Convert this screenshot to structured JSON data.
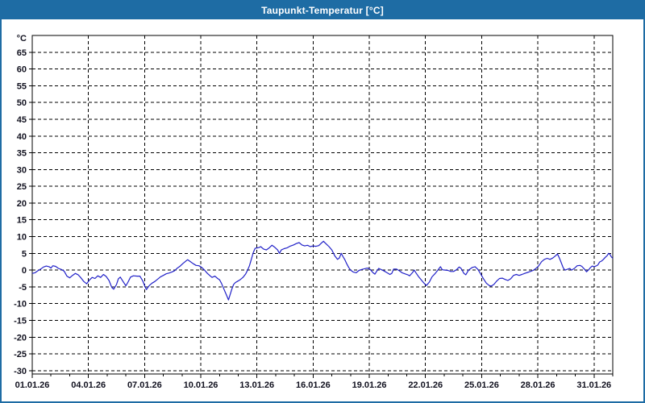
{
  "window": {
    "title": "Taupunkt-Temperatur [°C]",
    "titlebar_color": "#1e6ca4",
    "border_color": "#1e6ca4",
    "content_background": "#ffffff"
  },
  "chart_data": {
    "type": "line",
    "title": "Taupunkt-Temperatur [°C]",
    "y_unit_label": "°C",
    "ylabel": "",
    "xlabel": "",
    "ylim": [
      -31,
      70
    ],
    "y_ticks": [
      65,
      60,
      55,
      50,
      45,
      40,
      35,
      30,
      25,
      20,
      15,
      10,
      5,
      0,
      -5,
      -10,
      -15,
      -20,
      -25,
      -30
    ],
    "x_total_days": 31,
    "x_ticks": [
      {
        "day": 0,
        "label": "01.01.26"
      },
      {
        "day": 3,
        "label": "04.01.26"
      },
      {
        "day": 6,
        "label": "07.01.26"
      },
      {
        "day": 9,
        "label": "10.01.26"
      },
      {
        "day": 12,
        "label": "13.01.26"
      },
      {
        "day": 15,
        "label": "16.01.26"
      },
      {
        "day": 18,
        "label": "19.01.26"
      },
      {
        "day": 21,
        "label": "22.01.26"
      },
      {
        "day": 24,
        "label": "25.01.26"
      },
      {
        "day": 27,
        "label": "28.01.26"
      },
      {
        "day": 30,
        "label": "31.01.26"
      }
    ],
    "x_minor_tick_every_days": 1,
    "grid": "dashed",
    "grid_color": "#000000",
    "axis_color": "#000000",
    "line_color": "#2121c8",
    "legend": "none",
    "series": [
      {
        "name": "Taupunkt-Temperatur",
        "points": [
          [
            0.0,
            -1.0
          ],
          [
            0.15,
            -0.8
          ],
          [
            0.3,
            -0.2
          ],
          [
            0.45,
            0.3
          ],
          [
            0.6,
            0.9
          ],
          [
            0.75,
            1.2
          ],
          [
            0.9,
            1.0
          ],
          [
            1.0,
            0.6
          ],
          [
            1.1,
            1.3
          ],
          [
            1.25,
            1.1
          ],
          [
            1.4,
            0.5
          ],
          [
            1.55,
            0.2
          ],
          [
            1.7,
            -0.3
          ],
          [
            1.85,
            -1.8
          ],
          [
            2.0,
            -2.3
          ],
          [
            2.15,
            -1.6
          ],
          [
            2.3,
            -1.0
          ],
          [
            2.45,
            -1.4
          ],
          [
            2.6,
            -2.3
          ],
          [
            2.75,
            -3.4
          ],
          [
            2.9,
            -4.1
          ],
          [
            3.05,
            -3.0
          ],
          [
            3.2,
            -2.2
          ],
          [
            3.35,
            -2.5
          ],
          [
            3.5,
            -1.7
          ],
          [
            3.65,
            -2.2
          ],
          [
            3.8,
            -1.3
          ],
          [
            3.95,
            -1.9
          ],
          [
            4.1,
            -3.1
          ],
          [
            4.25,
            -5.2
          ],
          [
            4.35,
            -5.7
          ],
          [
            4.5,
            -4.3
          ],
          [
            4.6,
            -2.6
          ],
          [
            4.7,
            -2.1
          ],
          [
            4.85,
            -3.4
          ],
          [
            5.0,
            -4.7
          ],
          [
            5.1,
            -3.7
          ],
          [
            5.25,
            -2.1
          ],
          [
            5.4,
            -1.7
          ],
          [
            5.6,
            -1.8
          ],
          [
            5.75,
            -1.8
          ],
          [
            5.9,
            -3.2
          ],
          [
            6.05,
            -5.3
          ],
          [
            6.1,
            -5.8
          ],
          [
            6.25,
            -4.6
          ],
          [
            6.4,
            -3.9
          ],
          [
            6.55,
            -3.4
          ],
          [
            6.7,
            -2.7
          ],
          [
            6.85,
            -2.0
          ],
          [
            7.0,
            -1.6
          ],
          [
            7.15,
            -1.1
          ],
          [
            7.3,
            -0.9
          ],
          [
            7.45,
            -0.6
          ],
          [
            7.6,
            -0.2
          ],
          [
            7.75,
            0.6
          ],
          [
            7.9,
            1.2
          ],
          [
            8.05,
            2.0
          ],
          [
            8.2,
            2.7
          ],
          [
            8.3,
            3.1
          ],
          [
            8.45,
            2.5
          ],
          [
            8.6,
            1.9
          ],
          [
            8.75,
            1.4
          ],
          [
            8.9,
            1.3
          ],
          [
            9.05,
            0.8
          ],
          [
            9.2,
            0.0
          ],
          [
            9.35,
            -1.0
          ],
          [
            9.5,
            -1.7
          ],
          [
            9.6,
            -2.2
          ],
          [
            9.75,
            -1.8
          ],
          [
            9.9,
            -2.5
          ],
          [
            10.0,
            -2.9
          ],
          [
            10.1,
            -3.9
          ],
          [
            10.2,
            -5.2
          ],
          [
            10.3,
            -6.5
          ],
          [
            10.4,
            -7.8
          ],
          [
            10.48,
            -8.9
          ],
          [
            10.56,
            -7.4
          ],
          [
            10.65,
            -5.8
          ],
          [
            10.75,
            -4.3
          ],
          [
            10.85,
            -3.7
          ],
          [
            10.95,
            -3.4
          ],
          [
            11.1,
            -2.9
          ],
          [
            11.25,
            -2.2
          ],
          [
            11.4,
            -1.1
          ],
          [
            11.5,
            0.0
          ],
          [
            11.6,
            1.3
          ],
          [
            11.7,
            3.2
          ],
          [
            11.8,
            5.2
          ],
          [
            11.9,
            6.5
          ],
          [
            12.0,
            6.6
          ],
          [
            12.1,
            6.7
          ],
          [
            12.2,
            7.0
          ],
          [
            12.35,
            6.3
          ],
          [
            12.5,
            6.0
          ],
          [
            12.65,
            6.6
          ],
          [
            12.8,
            7.4
          ],
          [
            12.95,
            6.8
          ],
          [
            13.1,
            6.0
          ],
          [
            13.2,
            5.0
          ],
          [
            13.3,
            6.0
          ],
          [
            13.45,
            6.4
          ],
          [
            13.6,
            6.6
          ],
          [
            13.75,
            7.1
          ],
          [
            13.95,
            7.5
          ],
          [
            14.1,
            7.9
          ],
          [
            14.25,
            8.2
          ],
          [
            14.4,
            7.5
          ],
          [
            14.55,
            7.2
          ],
          [
            14.7,
            7.4
          ],
          [
            14.85,
            7.0
          ],
          [
            15.0,
            7.2
          ],
          [
            15.15,
            7.1
          ],
          [
            15.3,
            7.3
          ],
          [
            15.45,
            8.1
          ],
          [
            15.55,
            8.6
          ],
          [
            15.7,
            7.8
          ],
          [
            15.85,
            7.0
          ],
          [
            16.0,
            6.0
          ],
          [
            16.15,
            4.3
          ],
          [
            16.3,
            3.2
          ],
          [
            16.4,
            3.6
          ],
          [
            16.5,
            5.0
          ],
          [
            16.6,
            4.0
          ],
          [
            16.7,
            3.0
          ],
          [
            16.8,
            1.8
          ],
          [
            16.9,
            0.8
          ],
          [
            17.0,
            0.0
          ],
          [
            17.15,
            -0.6
          ],
          [
            17.3,
            -0.8
          ],
          [
            17.45,
            -0.1
          ],
          [
            17.6,
            0.2
          ],
          [
            17.75,
            0.4
          ],
          [
            17.9,
            0.6
          ],
          [
            18.05,
            0.2
          ],
          [
            18.2,
            -0.8
          ],
          [
            18.3,
            -1.2
          ],
          [
            18.4,
            -0.3
          ],
          [
            18.5,
            0.5
          ],
          [
            18.65,
            0.1
          ],
          [
            18.8,
            -0.3
          ],
          [
            18.95,
            -0.8
          ],
          [
            19.1,
            -1.3
          ],
          [
            19.2,
            -1.0
          ],
          [
            19.3,
            0.3
          ],
          [
            19.45,
            0.3
          ],
          [
            19.6,
            -0.2
          ],
          [
            19.75,
            -0.8
          ],
          [
            19.9,
            -1.1
          ],
          [
            20.05,
            -1.4
          ],
          [
            20.15,
            -1.7
          ],
          [
            20.3,
            -0.8
          ],
          [
            20.4,
            0.0
          ],
          [
            20.5,
            -0.9
          ],
          [
            20.65,
            -2.1
          ],
          [
            20.8,
            -3.1
          ],
          [
            20.95,
            -4.1
          ],
          [
            21.05,
            -4.6
          ],
          [
            21.2,
            -3.6
          ],
          [
            21.35,
            -2.0
          ],
          [
            21.5,
            -1.1
          ],
          [
            21.65,
            -0.1
          ],
          [
            21.8,
            1.0
          ],
          [
            21.9,
            0.1
          ],
          [
            22.05,
            0.0
          ],
          [
            22.2,
            -0.1
          ],
          [
            22.35,
            -0.4
          ],
          [
            22.5,
            -0.4
          ],
          [
            22.65,
            0.1
          ],
          [
            22.8,
            0.9
          ],
          [
            22.9,
            0.5
          ],
          [
            23.05,
            -1.0
          ],
          [
            23.15,
            -1.4
          ],
          [
            23.3,
            0.0
          ],
          [
            23.5,
            0.8
          ],
          [
            23.65,
            1.0
          ],
          [
            23.8,
            0.2
          ],
          [
            23.95,
            -1.2
          ],
          [
            24.1,
            -2.6
          ],
          [
            24.25,
            -3.9
          ],
          [
            24.4,
            -4.6
          ],
          [
            24.5,
            -4.8
          ],
          [
            24.65,
            -4.3
          ],
          [
            24.8,
            -3.3
          ],
          [
            24.95,
            -2.5
          ],
          [
            25.1,
            -2.4
          ],
          [
            25.25,
            -2.8
          ],
          [
            25.4,
            -3.1
          ],
          [
            25.55,
            -2.6
          ],
          [
            25.7,
            -1.6
          ],
          [
            25.85,
            -1.3
          ],
          [
            26.0,
            -1.6
          ],
          [
            26.15,
            -1.3
          ],
          [
            26.3,
            -1.0
          ],
          [
            26.45,
            -0.7
          ],
          [
            26.6,
            -0.4
          ],
          [
            26.75,
            -0.1
          ],
          [
            26.9,
            0.5
          ],
          [
            27.05,
            1.3
          ],
          [
            27.2,
            2.5
          ],
          [
            27.35,
            3.2
          ],
          [
            27.5,
            3.5
          ],
          [
            27.65,
            3.2
          ],
          [
            27.8,
            3.6
          ],
          [
            27.95,
            4.3
          ],
          [
            28.05,
            4.8
          ],
          [
            28.15,
            3.6
          ],
          [
            28.25,
            2.2
          ],
          [
            28.35,
            0.7
          ],
          [
            28.45,
            0.0
          ],
          [
            28.55,
            0.2
          ],
          [
            28.7,
            0.5
          ],
          [
            28.8,
            0.0
          ],
          [
            28.95,
            0.5
          ],
          [
            29.1,
            1.3
          ],
          [
            29.25,
            1.4
          ],
          [
            29.35,
            1.1
          ],
          [
            29.5,
            0.2
          ],
          [
            29.6,
            -0.5
          ],
          [
            29.7,
            0.0
          ],
          [
            29.8,
            0.7
          ],
          [
            29.9,
            1.2
          ],
          [
            30.0,
            1.0
          ],
          [
            30.1,
            1.2
          ],
          [
            30.2,
            1.5
          ],
          [
            30.3,
            2.4
          ],
          [
            30.4,
            2.7
          ],
          [
            30.5,
            3.2
          ],
          [
            30.6,
            3.8
          ],
          [
            30.7,
            4.3
          ],
          [
            30.78,
            5.0
          ],
          [
            30.85,
            4.7
          ],
          [
            30.92,
            4.0
          ],
          [
            31.0,
            3.5
          ]
        ]
      }
    ]
  }
}
